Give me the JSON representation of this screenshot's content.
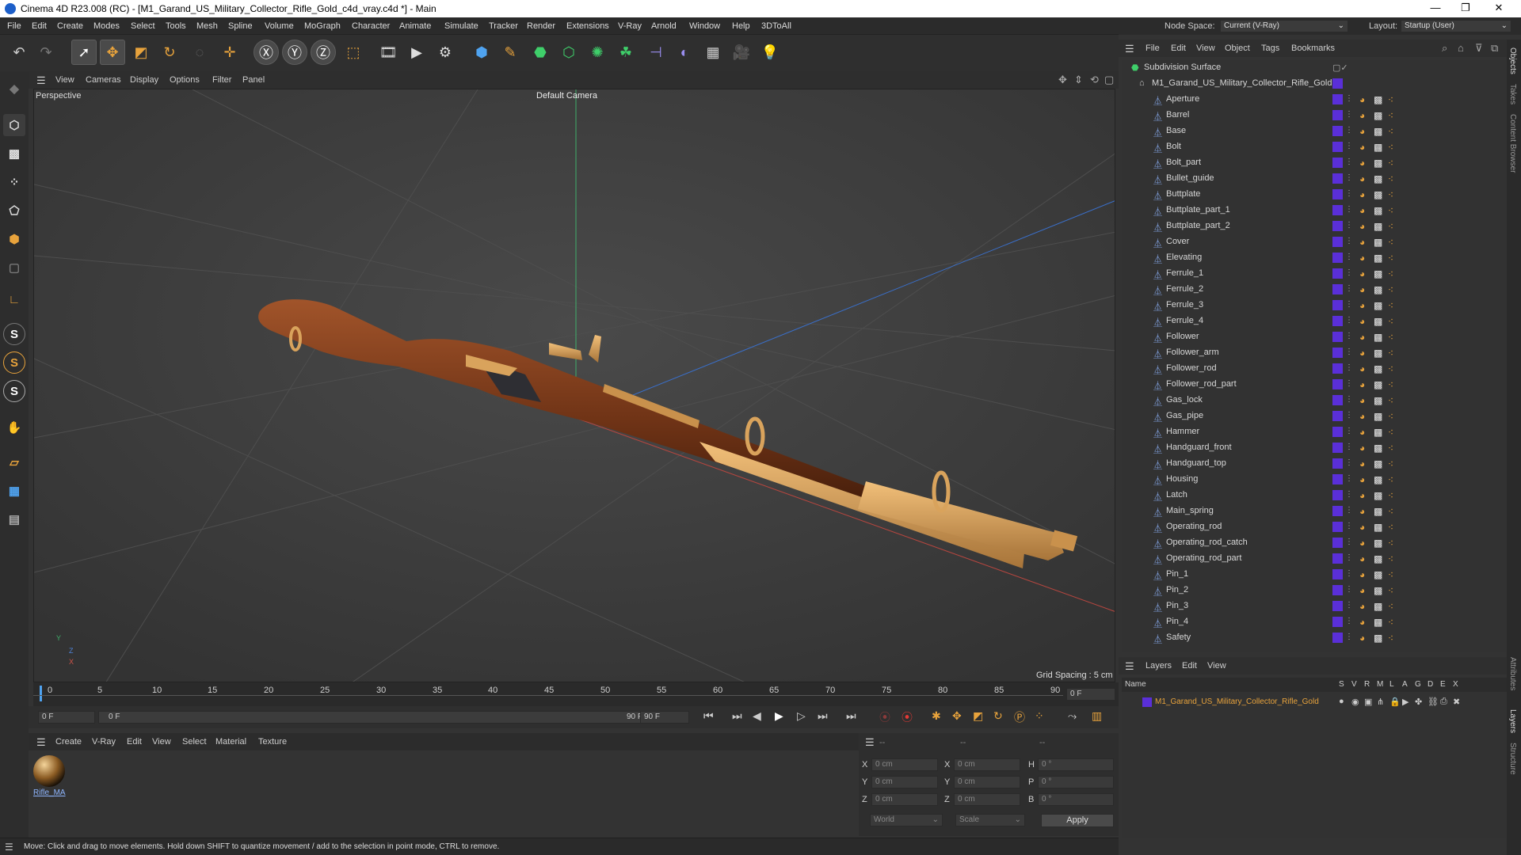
{
  "window": {
    "title": "Cinema 4D R23.008 (RC) - [M1_Garand_US_Military_Collector_Rifle_Gold_c4d_vray.c4d *] - Main",
    "controls": [
      "—",
      "❐",
      "✕"
    ]
  },
  "menubar": [
    "File",
    "Edit",
    "Create",
    "Modes",
    "Select",
    "Tools",
    "Mesh",
    "Spline",
    "Volume",
    "MoGraph",
    "Character",
    "Animate",
    "Simulate",
    "Tracker",
    "Render",
    "Extensions",
    "V-Ray",
    "Arnold",
    "Window",
    "Help",
    "3DToAll"
  ],
  "node_space": {
    "label": "Node Space:",
    "value": "Current (V-Ray)",
    "layout_label": "Layout:",
    "layout_value": "Startup (User)"
  },
  "viewport": {
    "menu": [
      "View",
      "Cameras",
      "Display",
      "Options",
      "Filter",
      "Panel"
    ],
    "view_name": "Perspective",
    "camera": "Default Camera",
    "grid_spacing": "Grid Spacing : 5 cm",
    "axis_labels": {
      "y": "Y",
      "z": "Z",
      "x": "X"
    }
  },
  "timeline": {
    "ticks": [
      "0",
      "5",
      "10",
      "15",
      "20",
      "25",
      "30",
      "35",
      "40",
      "45",
      "50",
      "55",
      "60",
      "65",
      "70",
      "75",
      "80",
      "85",
      "90"
    ],
    "current_frame": "0 F",
    "start": "0 F",
    "range_start": "0 F",
    "range_end": "90 F",
    "end": "90 F"
  },
  "material_panel": {
    "menu": [
      "Create",
      "V-Ray",
      "Edit",
      "View",
      "Select",
      "Material",
      "Texture"
    ],
    "materials": [
      {
        "name": "Rifle_MA"
      }
    ]
  },
  "coords": {
    "headers": [
      "--",
      "--",
      "--"
    ],
    "rows": [
      {
        "a": "X",
        "av": "0 cm",
        "b": "X",
        "bv": "0 cm",
        "c": "H",
        "cv": "0 °"
      },
      {
        "a": "Y",
        "av": "0 cm",
        "b": "Y",
        "bv": "0 cm",
        "c": "P",
        "cv": "0 °"
      },
      {
        "a": "Z",
        "av": "0 cm",
        "b": "Z",
        "bv": "0 cm",
        "c": "B",
        "cv": "0 °"
      }
    ],
    "mode": "World",
    "scale": "Scale",
    "apply": "Apply"
  },
  "status": "Move: Click and drag to move elements. Hold down SHIFT to quantize movement / add to the selection in point mode, CTRL to remove.",
  "objects": {
    "menu": [
      "File",
      "Edit",
      "View",
      "Object",
      "Tags",
      "Bookmarks"
    ],
    "root": "Subdivision Surface",
    "group": "M1_Garand_US_Military_Collector_Rifle_Gold",
    "items": [
      "Aperture",
      "Barrel",
      "Base",
      "Bolt",
      "Bolt_part",
      "Bullet_guide",
      "Buttplate",
      "Buttplate_part_1",
      "Buttplate_part_2",
      "Cover",
      "Elevating",
      "Ferrule_1",
      "Ferrule_2",
      "Ferrule_3",
      "Ferrule_4",
      "Follower",
      "Follower_arm",
      "Follower_rod",
      "Follower_rod_part",
      "Gas_lock",
      "Gas_pipe",
      "Hammer",
      "Handguard_front",
      "Handguard_top",
      "Housing",
      "Latch",
      "Main_spring",
      "Operating_rod",
      "Operating_rod_catch",
      "Operating_rod_part",
      "Pin_1",
      "Pin_2",
      "Pin_3",
      "Pin_4",
      "Safety"
    ]
  },
  "layers": {
    "menu": [
      "Layers",
      "Edit",
      "View"
    ],
    "name_header": "Name",
    "flags": [
      "S",
      "V",
      "R",
      "M",
      "L",
      "A",
      "G",
      "D",
      "E",
      "X"
    ],
    "items": [
      {
        "name": "M1_Garand_US_Military_Collector_Rifle_Gold"
      }
    ]
  },
  "side_tabs": [
    "Objects",
    "Takes",
    "Content Browser",
    "Attributes",
    "Layers",
    "Structure"
  ],
  "colors": {
    "layer_purple": "#5a2fd8",
    "gold": "#d9a35c",
    "wood": "#7a3a1a",
    "accent_blue": "#1d5fc9"
  }
}
